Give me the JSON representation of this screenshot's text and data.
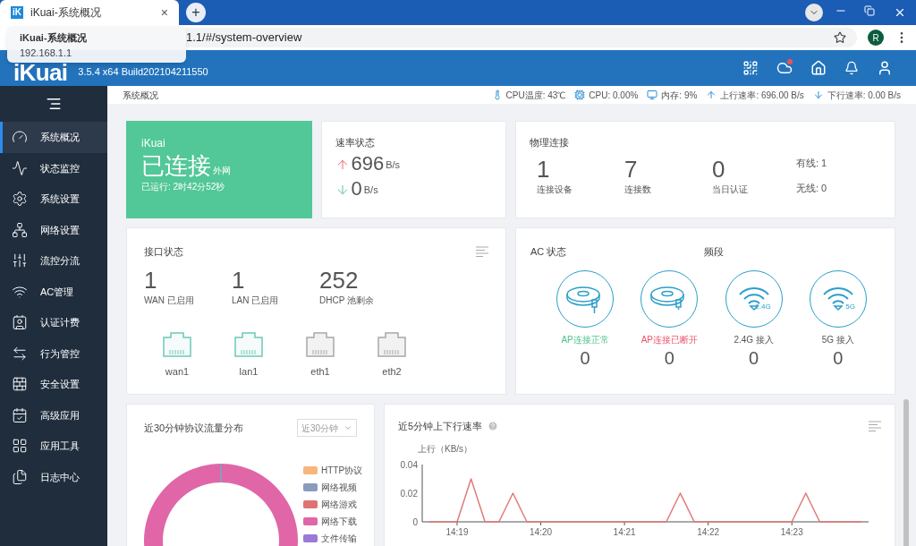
{
  "browser": {
    "tab": {
      "favicon": "iK",
      "title": "iKuai-系统概况",
      "close": "×"
    },
    "new_tab": "+",
    "tooltip": {
      "title": "iKuai-系统概况",
      "url": "192.168.1.1"
    },
    "address": "1.1/#/system-overview",
    "profile_initial": "R"
  },
  "app_header": {
    "logo": "iKuai",
    "version": "3.5.4 x64 Build202104211550",
    "cloud_alert": true
  },
  "sidebar": {
    "items": [
      {
        "label": "系统概况",
        "selected": true
      },
      {
        "label": "状态监控",
        "selected": false
      },
      {
        "label": "系统设置",
        "selected": false
      },
      {
        "label": "网络设置",
        "selected": false
      },
      {
        "label": "流控分流",
        "selected": false
      },
      {
        "label": "AC管理",
        "selected": false
      },
      {
        "label": "认证计费",
        "selected": false
      },
      {
        "label": "行为管控",
        "selected": false
      },
      {
        "label": "安全设置",
        "selected": false
      },
      {
        "label": "高级应用",
        "selected": false
      },
      {
        "label": "应用工具",
        "selected": false
      },
      {
        "label": "日志中心",
        "selected": false
      }
    ]
  },
  "breadcrumb": "系统概况",
  "stats": [
    {
      "kind": "temperature",
      "text": "CPU温度: 43℃"
    },
    {
      "kind": "cpu",
      "text": "CPU: 0.00%"
    },
    {
      "kind": "memory",
      "text": "内存: 9%"
    },
    {
      "kind": "up",
      "text": "上行速率: 696.00 B/s"
    },
    {
      "kind": "down",
      "text": "下行速率: 0.00 B/s"
    }
  ],
  "connection": {
    "brand": "iKuai",
    "status": "已连接",
    "network": "外网",
    "uptime": "已运行: 2时42分52秒"
  },
  "speed": {
    "title": "速率状态",
    "up": {
      "value": "696",
      "unit": "B/s"
    },
    "down": {
      "value": "0",
      "unit": "B/s"
    }
  },
  "physical": {
    "title": "物理连接",
    "stats": [
      {
        "value": "1",
        "label": "连接设备"
      },
      {
        "value": "7",
        "label": "连接数"
      },
      {
        "value": "0",
        "label": "当日认证"
      }
    ],
    "wired": "有线: 1",
    "wireless": "无线: 0"
  },
  "interfaces": {
    "title": "接口状态",
    "stats": [
      {
        "value": "1",
        "label": "WAN 已启用"
      },
      {
        "value": "1",
        "label": "LAN 已启用"
      },
      {
        "value": "252",
        "label": "DHCP 池剩余"
      }
    ],
    "ports": [
      {
        "name": "wan1",
        "enabled": true
      },
      {
        "name": "lan1",
        "enabled": true
      },
      {
        "name": "eth1",
        "enabled": false
      },
      {
        "name": "eth2",
        "enabled": false
      }
    ]
  },
  "ac": {
    "title": "AC 状态",
    "band_title": "频段",
    "items": [
      {
        "kind": "ap_online",
        "label": "AP连接正常",
        "count": "0"
      },
      {
        "kind": "ap_offline",
        "label": "AP连接已断开",
        "count": "0"
      },
      {
        "kind": "band",
        "badge": "2.4G",
        "label": "2.4G 接入",
        "count": "0"
      },
      {
        "kind": "band",
        "badge": "5G",
        "label": "5G 接入",
        "count": "0"
      }
    ]
  },
  "protocol": {
    "title": "近30分钟协议流量分布",
    "range": "近30分钟",
    "legend": [
      {
        "label": "HTTP协议",
        "color": "#f8b57e"
      },
      {
        "label": "网络视频",
        "color": "#8a9bbd"
      },
      {
        "label": "网络游戏",
        "color": "#e07272"
      },
      {
        "label": "网络下载",
        "color": "#e066a8"
      },
      {
        "label": "文件传输",
        "color": "#9a7ad6"
      }
    ]
  },
  "rate": {
    "title": "近5分钟上下行速率",
    "chart_data": {
      "type": "line",
      "ylabel": "上行（KB/s）",
      "categories": [
        null,
        null,
        "14:19",
        null,
        null,
        null,
        null,
        null,
        "14:20",
        null,
        null,
        null,
        null,
        null,
        "14:21",
        null,
        null,
        null,
        null,
        null,
        "14:22",
        null,
        null,
        null,
        null,
        null,
        "14:23",
        null,
        null,
        null,
        null,
        null
      ],
      "series": [
        {
          "color": "#e07a7a",
          "values": [
            0,
            0,
            0,
            0.03,
            0,
            0,
            0.02,
            0,
            0,
            0,
            0,
            0,
            0,
            0,
            0,
            0,
            0,
            0,
            0.02,
            0,
            0,
            0,
            0,
            0,
            0,
            0,
            0,
            0.02,
            0,
            0,
            0,
            0
          ]
        }
      ],
      "ylim": [
        0,
        0.04
      ],
      "yticks": [
        0,
        0.02,
        0.04
      ]
    }
  }
}
